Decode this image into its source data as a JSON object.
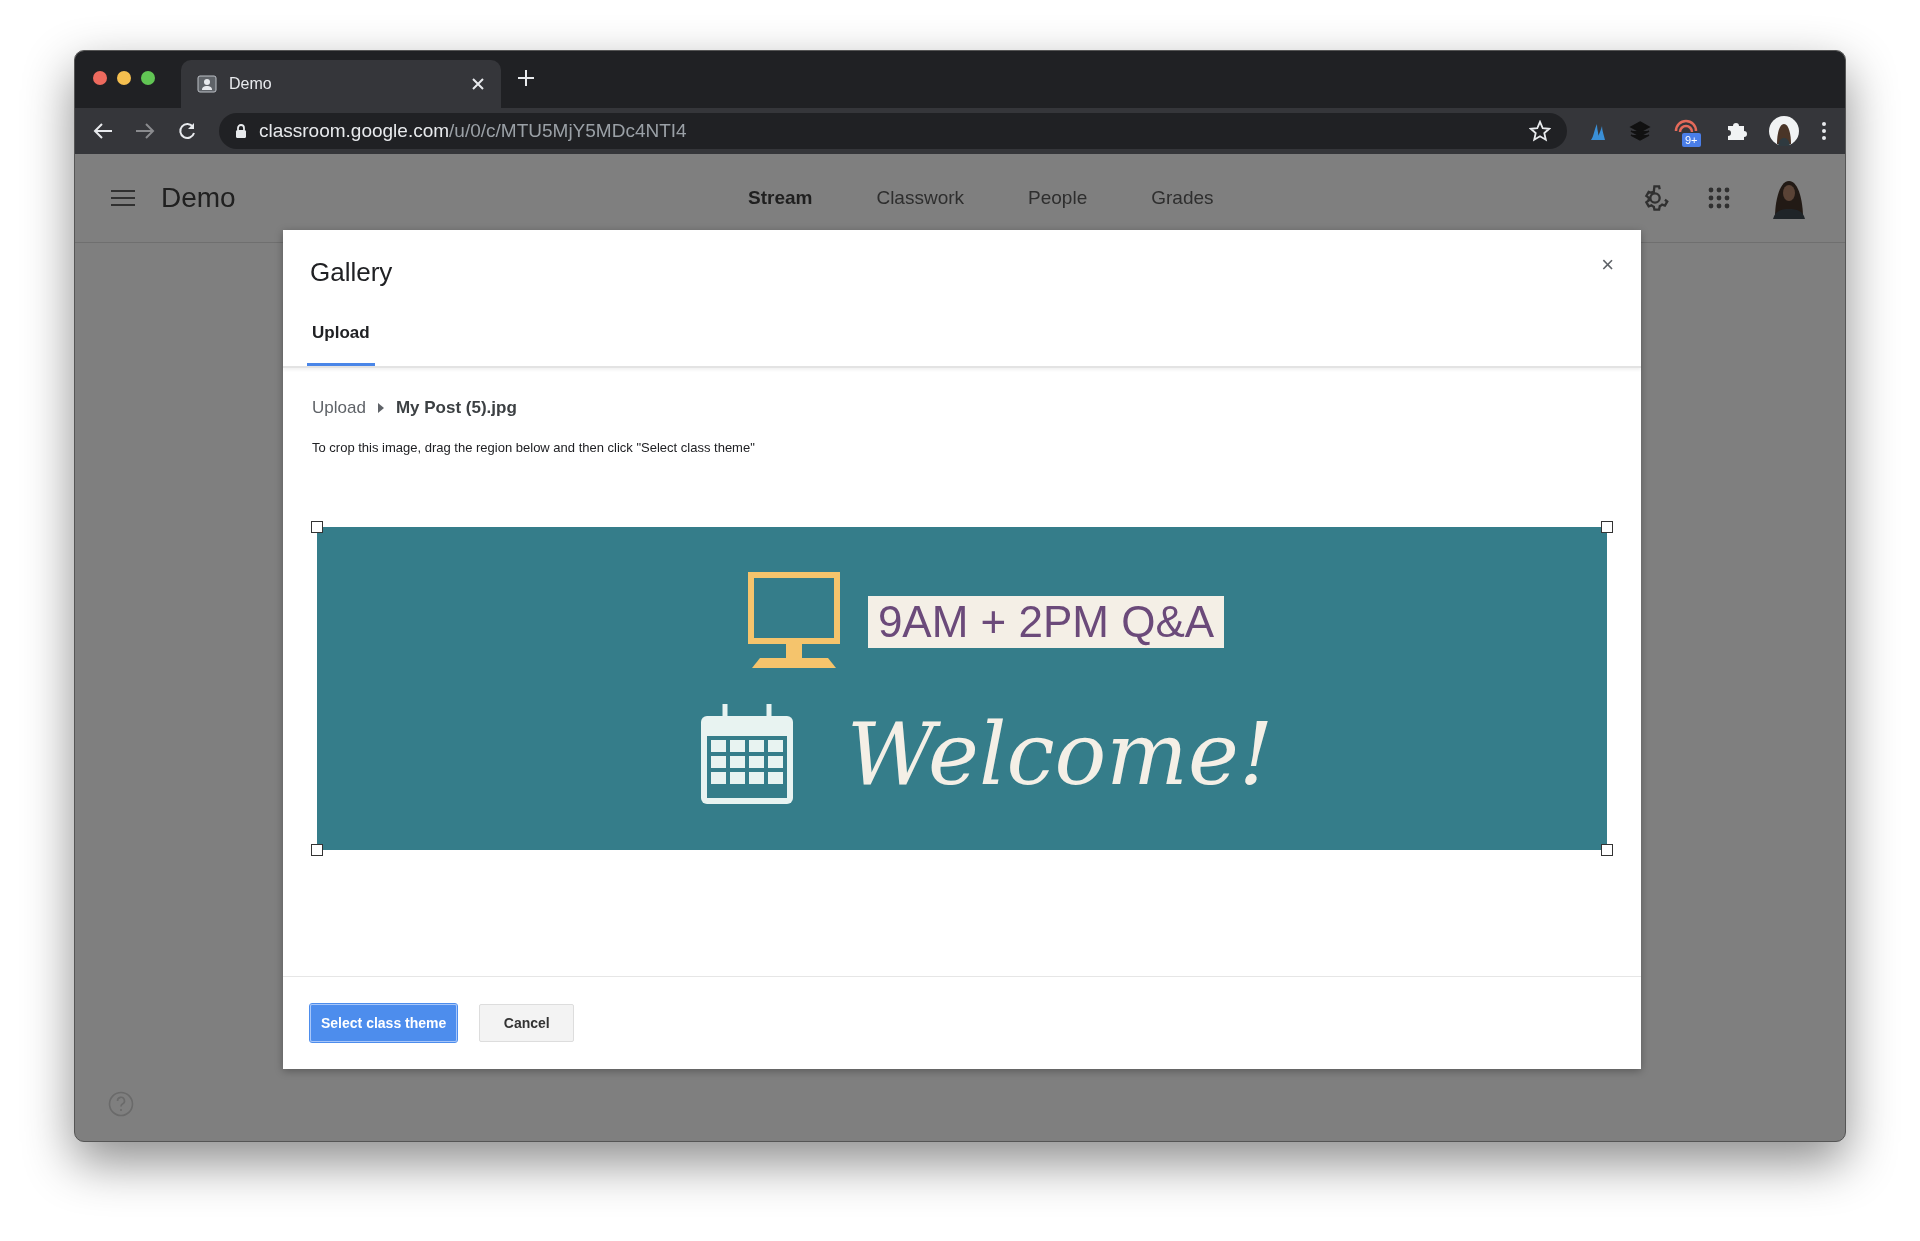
{
  "browser": {
    "tab": {
      "title": "Demo",
      "selected": true
    },
    "url": {
      "host": "classroom.google.com",
      "path": "/u/0/c/MTU5MjY5MDc4NTI4"
    },
    "extension_badge": "9+"
  },
  "app_bar": {
    "title": "Demo",
    "nav": [
      {
        "label": "Stream",
        "selected": true
      },
      {
        "label": "Classwork",
        "selected": false
      },
      {
        "label": "People",
        "selected": false
      },
      {
        "label": "Grades",
        "selected": false
      }
    ]
  },
  "dialog": {
    "title": "Gallery",
    "close": "×",
    "tabs": [
      {
        "label": "Upload",
        "selected": true
      }
    ],
    "breadcrumb": [
      "Upload",
      "My Post (5).jpg"
    ],
    "instruction": "To crop this image, drag the region below and then click \"Select class theme\"",
    "image": {
      "headline": "9AM + 2PM Q&A",
      "greeting": "Welcome!"
    },
    "buttons": [
      {
        "label": "Select class theme",
        "kind": "primary"
      },
      {
        "label": "Cancel",
        "kind": "secondary"
      }
    ]
  }
}
